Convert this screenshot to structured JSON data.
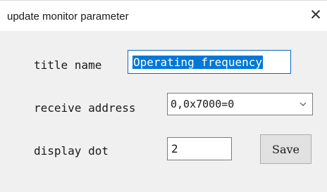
{
  "window": {
    "title": "update monitor parameter",
    "close_glyph": "✕"
  },
  "form": {
    "title_name_label": "title name",
    "title_name_value": "Operating frequency",
    "receive_address_label": "receive address",
    "receive_address_value": "0,0x7000=0",
    "display_dot_label": "display dot",
    "display_dot_value": "2",
    "save_label": "Save"
  },
  "icons": {
    "close": "close-icon",
    "dropdown": "chevron-down-icon"
  }
}
